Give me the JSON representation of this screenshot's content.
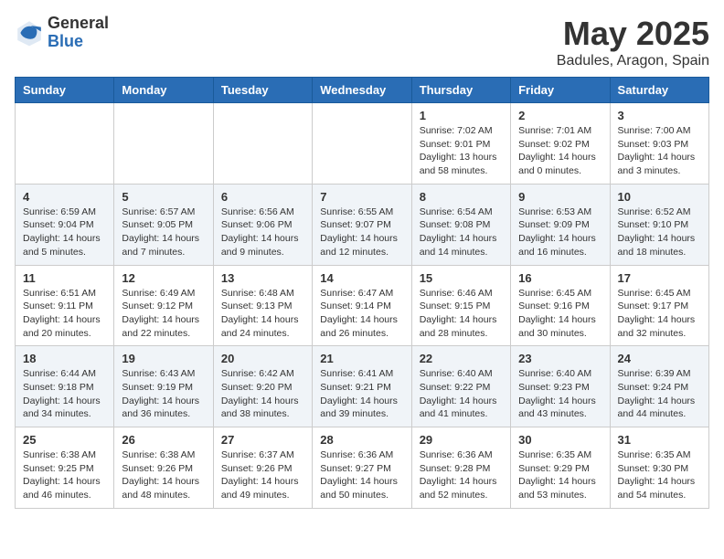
{
  "logo": {
    "general": "General",
    "blue": "Blue"
  },
  "header": {
    "month": "May 2025",
    "location": "Badules, Aragon, Spain"
  },
  "weekdays": [
    "Sunday",
    "Monday",
    "Tuesday",
    "Wednesday",
    "Thursday",
    "Friday",
    "Saturday"
  ],
  "weeks": [
    [
      {
        "day": "",
        "info": ""
      },
      {
        "day": "",
        "info": ""
      },
      {
        "day": "",
        "info": ""
      },
      {
        "day": "",
        "info": ""
      },
      {
        "day": "1",
        "info": "Sunrise: 7:02 AM\nSunset: 9:01 PM\nDaylight: 13 hours\nand 58 minutes."
      },
      {
        "day": "2",
        "info": "Sunrise: 7:01 AM\nSunset: 9:02 PM\nDaylight: 14 hours\nand 0 minutes."
      },
      {
        "day": "3",
        "info": "Sunrise: 7:00 AM\nSunset: 9:03 PM\nDaylight: 14 hours\nand 3 minutes."
      }
    ],
    [
      {
        "day": "4",
        "info": "Sunrise: 6:59 AM\nSunset: 9:04 PM\nDaylight: 14 hours\nand 5 minutes."
      },
      {
        "day": "5",
        "info": "Sunrise: 6:57 AM\nSunset: 9:05 PM\nDaylight: 14 hours\nand 7 minutes."
      },
      {
        "day": "6",
        "info": "Sunrise: 6:56 AM\nSunset: 9:06 PM\nDaylight: 14 hours\nand 9 minutes."
      },
      {
        "day": "7",
        "info": "Sunrise: 6:55 AM\nSunset: 9:07 PM\nDaylight: 14 hours\nand 12 minutes."
      },
      {
        "day": "8",
        "info": "Sunrise: 6:54 AM\nSunset: 9:08 PM\nDaylight: 14 hours\nand 14 minutes."
      },
      {
        "day": "9",
        "info": "Sunrise: 6:53 AM\nSunset: 9:09 PM\nDaylight: 14 hours\nand 16 minutes."
      },
      {
        "day": "10",
        "info": "Sunrise: 6:52 AM\nSunset: 9:10 PM\nDaylight: 14 hours\nand 18 minutes."
      }
    ],
    [
      {
        "day": "11",
        "info": "Sunrise: 6:51 AM\nSunset: 9:11 PM\nDaylight: 14 hours\nand 20 minutes."
      },
      {
        "day": "12",
        "info": "Sunrise: 6:49 AM\nSunset: 9:12 PM\nDaylight: 14 hours\nand 22 minutes."
      },
      {
        "day": "13",
        "info": "Sunrise: 6:48 AM\nSunset: 9:13 PM\nDaylight: 14 hours\nand 24 minutes."
      },
      {
        "day": "14",
        "info": "Sunrise: 6:47 AM\nSunset: 9:14 PM\nDaylight: 14 hours\nand 26 minutes."
      },
      {
        "day": "15",
        "info": "Sunrise: 6:46 AM\nSunset: 9:15 PM\nDaylight: 14 hours\nand 28 minutes."
      },
      {
        "day": "16",
        "info": "Sunrise: 6:45 AM\nSunset: 9:16 PM\nDaylight: 14 hours\nand 30 minutes."
      },
      {
        "day": "17",
        "info": "Sunrise: 6:45 AM\nSunset: 9:17 PM\nDaylight: 14 hours\nand 32 minutes."
      }
    ],
    [
      {
        "day": "18",
        "info": "Sunrise: 6:44 AM\nSunset: 9:18 PM\nDaylight: 14 hours\nand 34 minutes."
      },
      {
        "day": "19",
        "info": "Sunrise: 6:43 AM\nSunset: 9:19 PM\nDaylight: 14 hours\nand 36 minutes."
      },
      {
        "day": "20",
        "info": "Sunrise: 6:42 AM\nSunset: 9:20 PM\nDaylight: 14 hours\nand 38 minutes."
      },
      {
        "day": "21",
        "info": "Sunrise: 6:41 AM\nSunset: 9:21 PM\nDaylight: 14 hours\nand 39 minutes."
      },
      {
        "day": "22",
        "info": "Sunrise: 6:40 AM\nSunset: 9:22 PM\nDaylight: 14 hours\nand 41 minutes."
      },
      {
        "day": "23",
        "info": "Sunrise: 6:40 AM\nSunset: 9:23 PM\nDaylight: 14 hours\nand 43 minutes."
      },
      {
        "day": "24",
        "info": "Sunrise: 6:39 AM\nSunset: 9:24 PM\nDaylight: 14 hours\nand 44 minutes."
      }
    ],
    [
      {
        "day": "25",
        "info": "Sunrise: 6:38 AM\nSunset: 9:25 PM\nDaylight: 14 hours\nand 46 minutes."
      },
      {
        "day": "26",
        "info": "Sunrise: 6:38 AM\nSunset: 9:26 PM\nDaylight: 14 hours\nand 48 minutes."
      },
      {
        "day": "27",
        "info": "Sunrise: 6:37 AM\nSunset: 9:26 PM\nDaylight: 14 hours\nand 49 minutes."
      },
      {
        "day": "28",
        "info": "Sunrise: 6:36 AM\nSunset: 9:27 PM\nDaylight: 14 hours\nand 50 minutes."
      },
      {
        "day": "29",
        "info": "Sunrise: 6:36 AM\nSunset: 9:28 PM\nDaylight: 14 hours\nand 52 minutes."
      },
      {
        "day": "30",
        "info": "Sunrise: 6:35 AM\nSunset: 9:29 PM\nDaylight: 14 hours\nand 53 minutes."
      },
      {
        "day": "31",
        "info": "Sunrise: 6:35 AM\nSunset: 9:30 PM\nDaylight: 14 hours\nand 54 minutes."
      }
    ]
  ]
}
